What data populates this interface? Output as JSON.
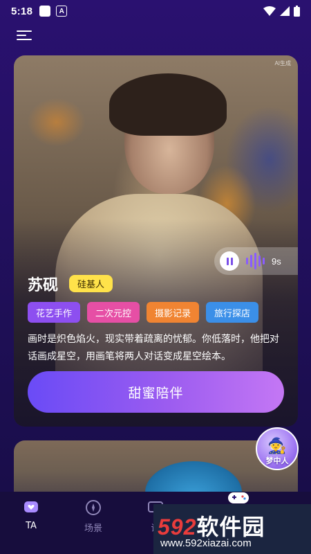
{
  "status_bar": {
    "time": "5:18"
  },
  "card": {
    "watermark": "AI生成",
    "name": "苏砚",
    "type_badge": "硅基人",
    "voice": {
      "duration": "9s"
    },
    "tags": [
      {
        "label": "花艺手作",
        "color": "#8d4ff0"
      },
      {
        "label": "二次元控",
        "color": "#e64fa5"
      },
      {
        "label": "摄影记录",
        "color": "#f08432"
      },
      {
        "label": "旅行探店",
        "color": "#3b8fe8"
      }
    ],
    "description": "画时是炽色焰火，现实带着疏离的忧郁。你低落时，他把对话画成星空，用画笔将两人对话变成星空绘本。",
    "cta": "甜蜜陪伴"
  },
  "floating_badge": {
    "label": "梦中人"
  },
  "bottom_nav": {
    "items": [
      {
        "label": "TA",
        "active": true
      },
      {
        "label": "场景",
        "active": false
      },
      {
        "label": "话",
        "active": false
      }
    ]
  },
  "watermark_banner": {
    "title_num": "592",
    "title_text": "软件园",
    "url": "www.592xiazai.com"
  }
}
